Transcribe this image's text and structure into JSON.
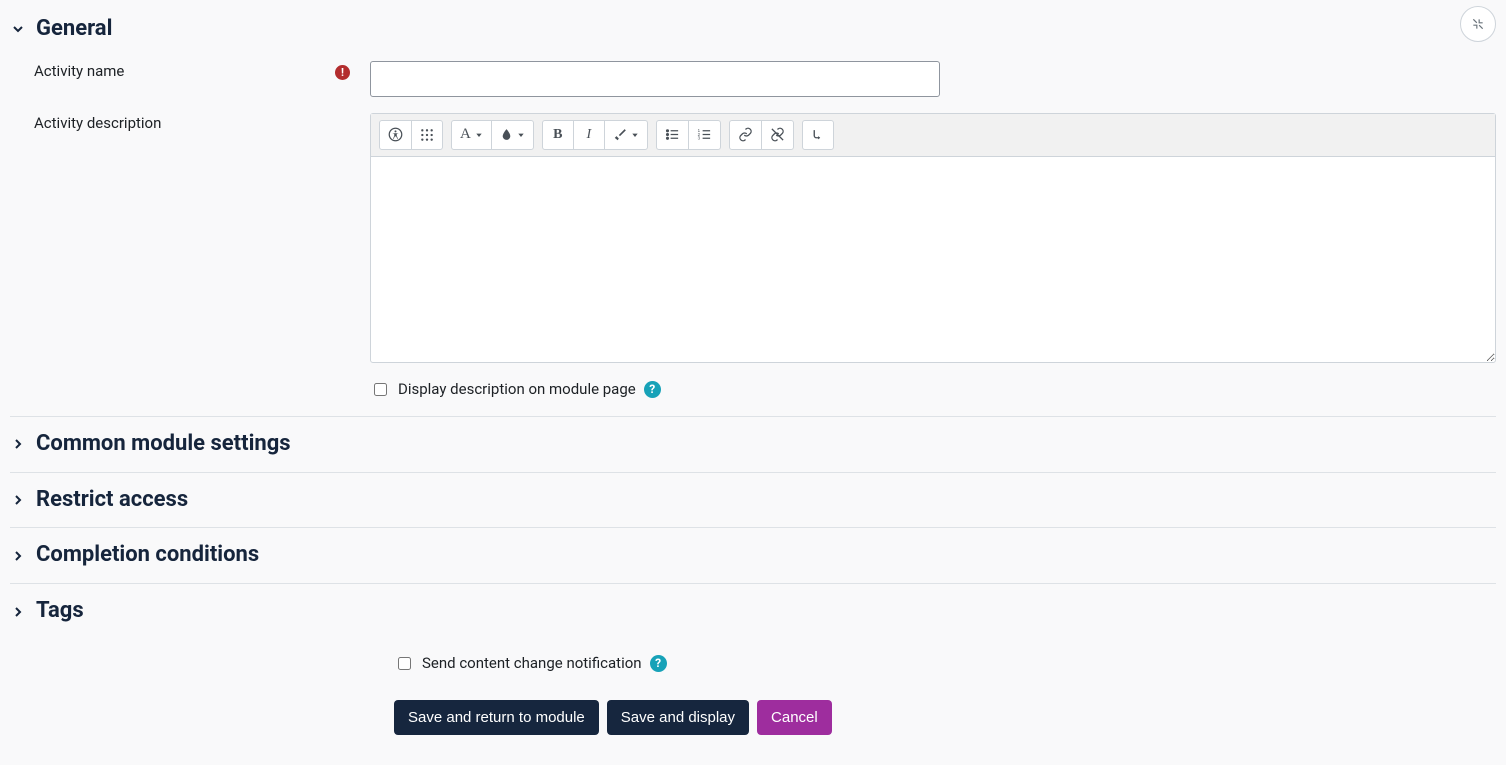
{
  "sections": {
    "general": "General",
    "common": "Common module settings",
    "restrict": "Restrict access",
    "completion": "Completion conditions",
    "tags": "Tags"
  },
  "labels": {
    "activity_name": "Activity name",
    "activity_description": "Activity description",
    "display_desc": "Display description on module page",
    "send_notif": "Send content change notification"
  },
  "buttons": {
    "save_return": "Save and return to module",
    "save_display": "Save and display",
    "cancel": "Cancel"
  },
  "values": {
    "activity_name": "",
    "display_desc_checked": false,
    "send_notif_checked": false
  },
  "editor_toolbar": {
    "a11y": "accessibility-checker",
    "grid": "toolbar-toggle",
    "font": "font-family",
    "color": "text-color",
    "bold": "bold",
    "italic": "italic",
    "clear": "highlight",
    "ul": "bullet-list",
    "ol": "numbered-list",
    "link": "insert-link",
    "unlink": "remove-link",
    "indent": "arrow-indent"
  }
}
